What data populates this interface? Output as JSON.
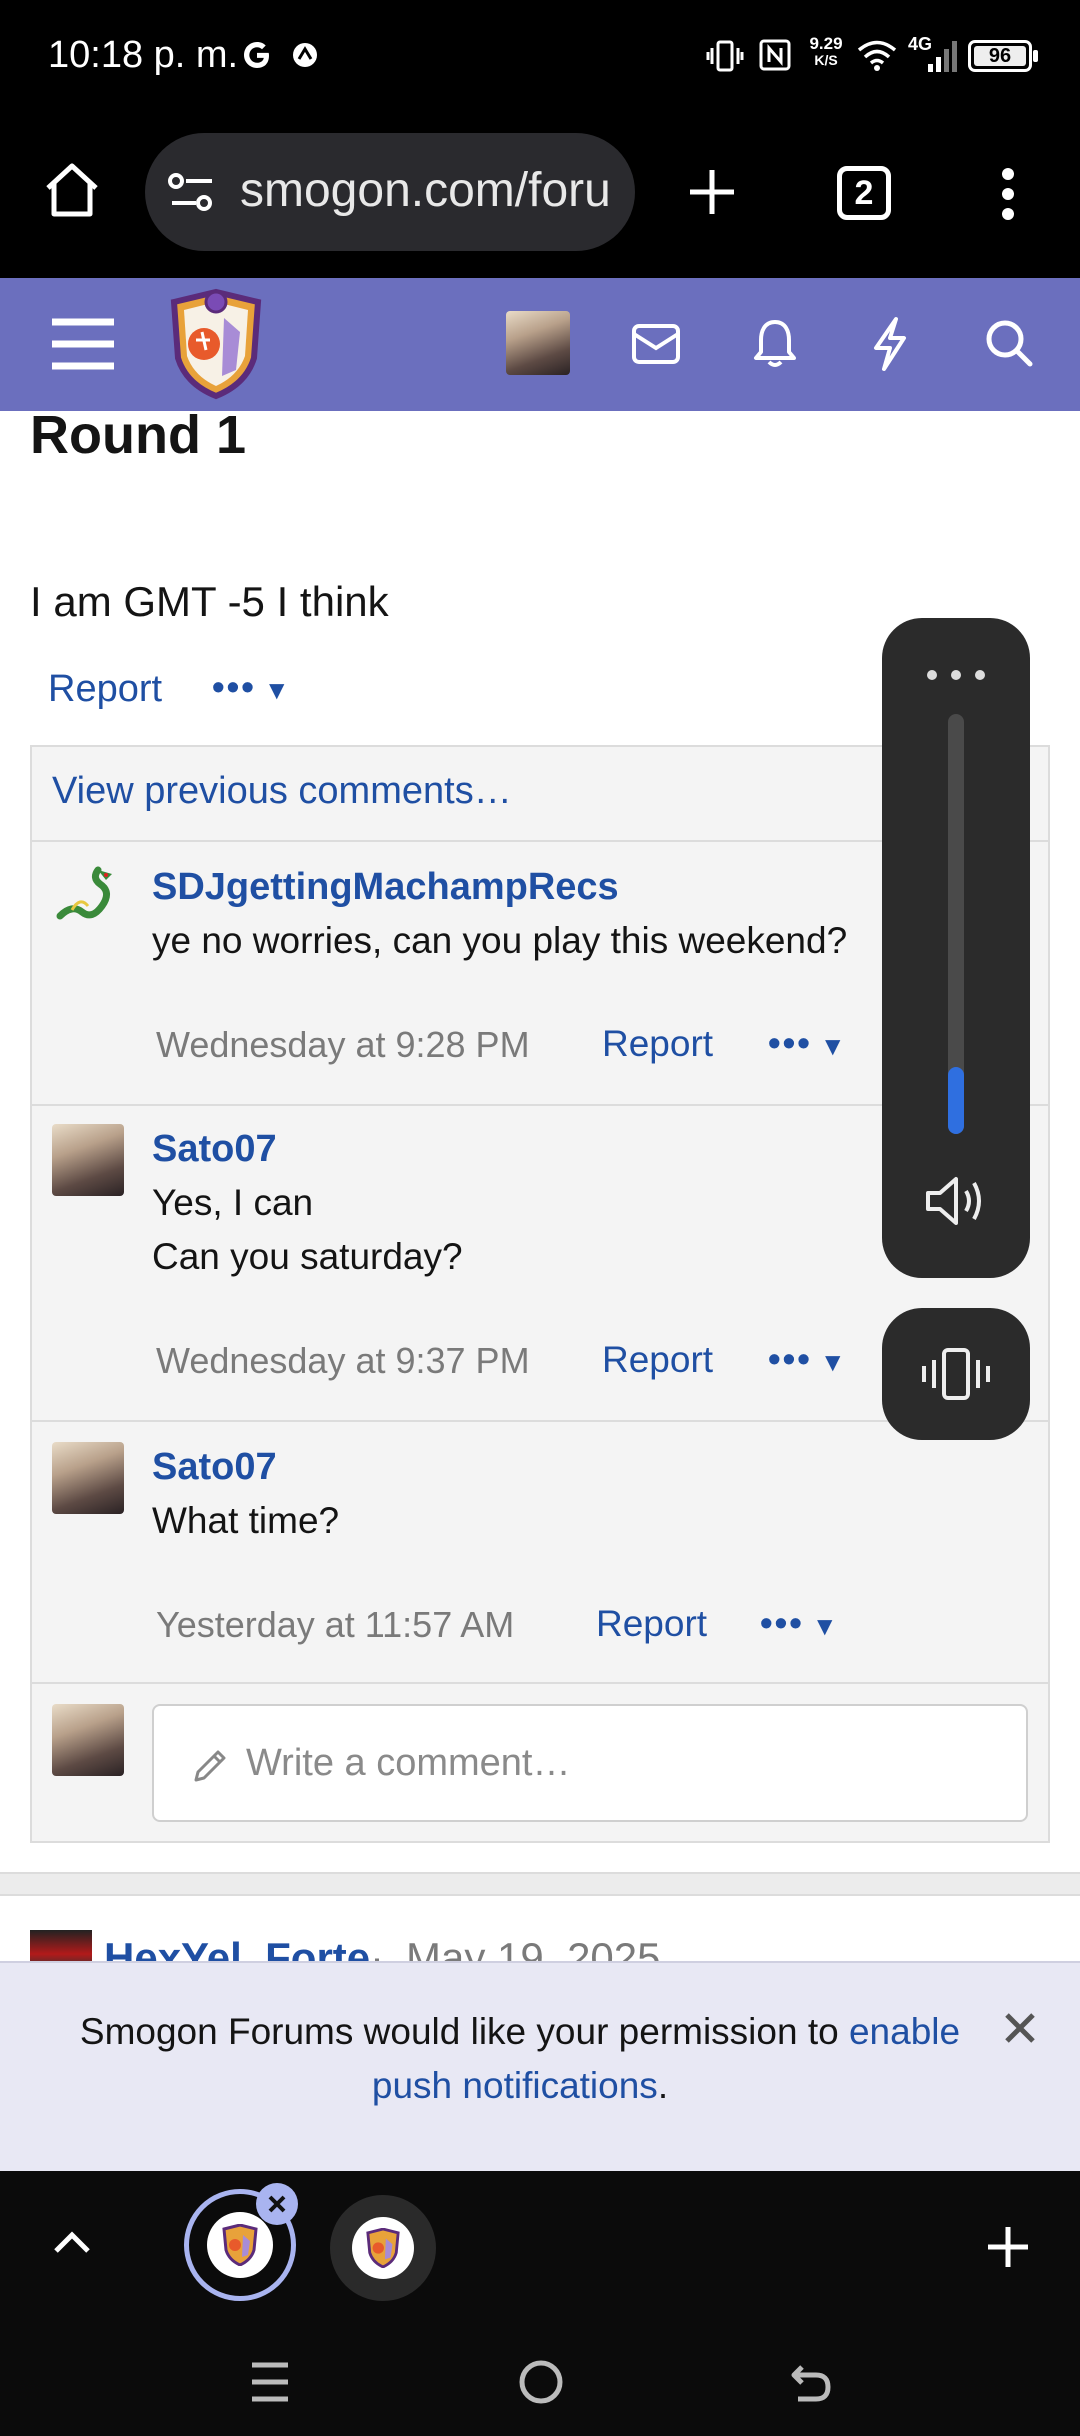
{
  "status_bar": {
    "time": "10:18 p. m.",
    "network_speed_value": "9.29",
    "network_speed_unit": "K/S",
    "network_type": "4G",
    "battery": "96"
  },
  "browser": {
    "url": "smogon.com/foru",
    "tab_count": "2"
  },
  "post": {
    "heading": "Round 1",
    "body": "I am GMT -5 I think",
    "report_label": "Report"
  },
  "comments": {
    "view_previous": "View previous comments…",
    "items": [
      {
        "user": "SDJgettingMachampRecs",
        "lines": [
          "ye no worries, can you play this weekend?"
        ],
        "time": "Wednesday at 9:28 PM",
        "report": "Report"
      },
      {
        "user": "Sato07",
        "lines": [
          "Yes, I can",
          "Can you saturday?"
        ],
        "time": "Wednesday at 9:37 PM",
        "report": "Report"
      },
      {
        "user": "Sato07",
        "lines": [
          "What time?"
        ],
        "time": "Yesterday at 11:57 AM",
        "report": "Report"
      }
    ],
    "write_placeholder": "Write a comment…"
  },
  "next_post": {
    "user": "HexYel_Forte",
    "date": "May 19, 2025"
  },
  "notification": {
    "text_before": "Smogon Forums would like your permission to ",
    "link_text": "enable push notifications",
    "text_after": "."
  },
  "volume": {
    "level": 0.16
  },
  "colors": {
    "forum_bar": "#6b6fbe",
    "link": "#1f4fa3",
    "volume_accent": "#2f6fe0"
  }
}
